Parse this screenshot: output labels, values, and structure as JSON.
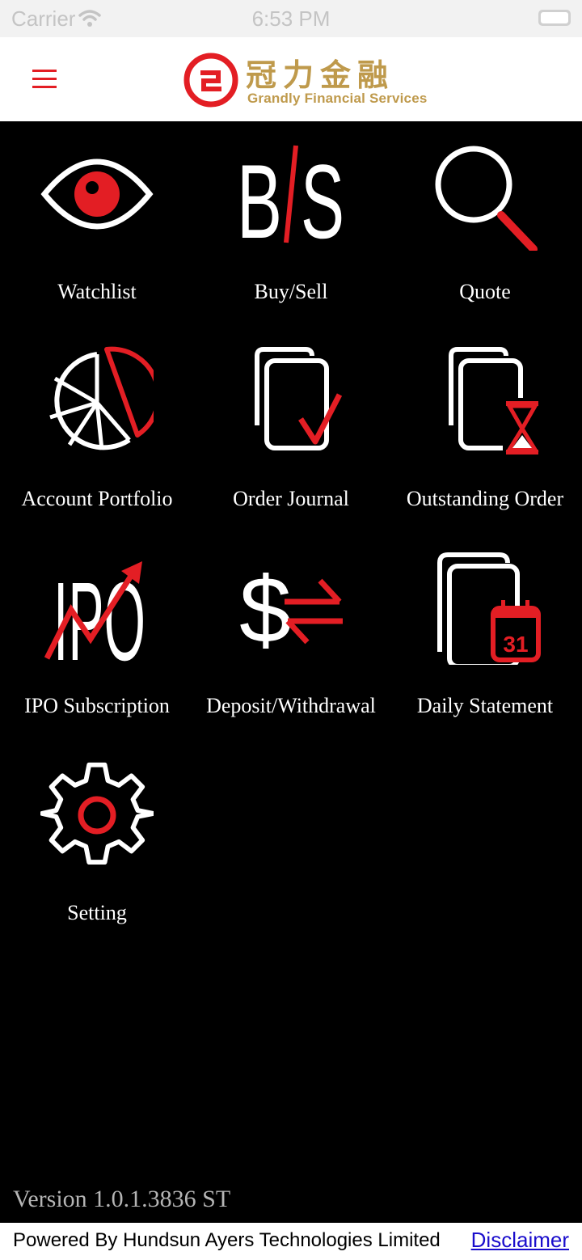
{
  "status_bar": {
    "carrier": "Carrier",
    "time": "6:53 PM",
    "icons": [
      "wifi-icon",
      "battery-icon"
    ]
  },
  "header": {
    "menu_icon": "hamburger-menu-icon",
    "logo_cn": "冠力金融",
    "logo_en": "Grandly Financial Services",
    "logo_icon": "grandly-logo-icon"
  },
  "menu": {
    "items": [
      {
        "label": "Watchlist",
        "icon": "eye-icon"
      },
      {
        "label": "Buy/Sell",
        "icon": "buy-sell-icon"
      },
      {
        "label": "Quote",
        "icon": "magnifier-icon"
      },
      {
        "label": "Account Portfolio",
        "icon": "pie-chart-icon"
      },
      {
        "label": "Order Journal",
        "icon": "documents-check-icon"
      },
      {
        "label": "Outstanding Order",
        "icon": "documents-hourglass-icon"
      },
      {
        "label": "IPO Subscription",
        "icon": "ipo-arrow-icon"
      },
      {
        "label": "Deposit/Withdrawal",
        "icon": "dollar-exchange-icon"
      },
      {
        "label": "Daily Statement",
        "icon": "documents-calendar-icon"
      },
      {
        "label": "Setting",
        "icon": "gear-icon"
      }
    ],
    "calendar_day": "31",
    "buy_sell_text": "B/S",
    "ipo_text": "IPO"
  },
  "footer": {
    "version": "Version 1.0.1.3836 ST",
    "powered_by": "Powered By Hundsun Ayers Technologies Limited",
    "disclaimer": "Disclaimer"
  },
  "colors": {
    "accent": "#e31e24",
    "brand_gold": "#bf9a4c",
    "background": "#000000",
    "icon_white": "#ffffff",
    "link": "#1a0dcc"
  }
}
